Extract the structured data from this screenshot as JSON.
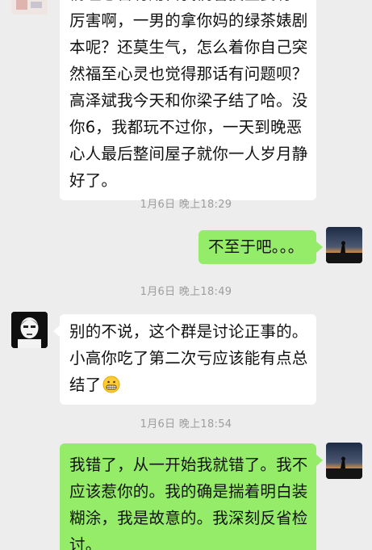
{
  "messages": [
    {
      "side": "left",
      "lines": [
        "厉害啊，一男的拿你妈的绿茶婊剧",
        "本呢？还莫生气，怎么着你自己突",
        "然福至心灵也觉得那话有问题呗？",
        "高泽斌我今天和你梁子结了哈。没",
        "你6，我都玩不过你，一天到晚恶",
        "心人最后整间屋子就你一人岁月静",
        "好了。"
      ]
    },
    {
      "timestamp": "1月6日 晚上18:29"
    },
    {
      "side": "right",
      "text": "不至于吧。。。"
    },
    {
      "timestamp": "1月6日 晚上18:49"
    },
    {
      "side": "left",
      "lines": [
        "别的不说，这个群是讨论正事的。",
        "小高你吃了第二次亏应该能有点总",
        "结了"
      ],
      "emoji": "grimacing-face"
    },
    {
      "timestamp": "1月6日 晚上18:54"
    },
    {
      "side": "right",
      "lines": [
        "我错了，从一开始我就错了。我不",
        "应该惹你的。我的确是揣着明白装",
        "糊涂，我是故意的。我深刻反省检",
        "讨。"
      ]
    }
  ],
  "colors": {
    "background": "#ededed",
    "incoming_bubble": "#ffffff",
    "outgoing_bubble": "#95ec69",
    "timestamp_text": "#9d9d9d"
  }
}
